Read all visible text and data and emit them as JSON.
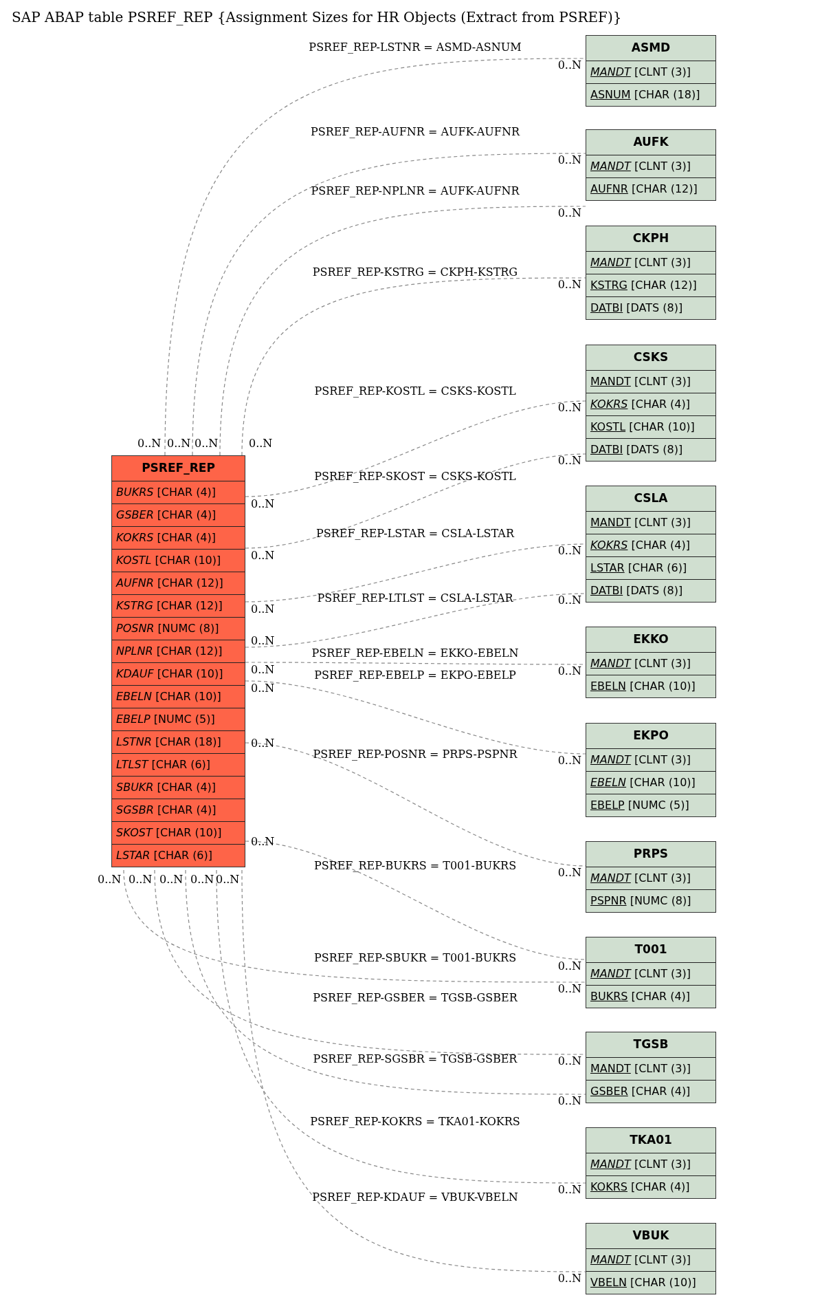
{
  "title": "SAP ABAP table PSREF_REP {Assignment Sizes for HR Objects (Extract from PSREF)}",
  "main_table": {
    "name": "PSREF_REP",
    "fields": [
      {
        "name": "BUKRS",
        "type": "[CHAR (4)]",
        "primary_key": false,
        "foreign_key": true
      },
      {
        "name": "GSBER",
        "type": "[CHAR (4)]",
        "primary_key": false,
        "foreign_key": true
      },
      {
        "name": "KOKRS",
        "type": "[CHAR (4)]",
        "primary_key": false,
        "foreign_key": true
      },
      {
        "name": "KOSTL",
        "type": "[CHAR (10)]",
        "primary_key": false,
        "foreign_key": true
      },
      {
        "name": "AUFNR",
        "type": "[CHAR (12)]",
        "primary_key": false,
        "foreign_key": true
      },
      {
        "name": "KSTRG",
        "type": "[CHAR (12)]",
        "primary_key": false,
        "foreign_key": true
      },
      {
        "name": "POSNR",
        "type": "[NUMC (8)]",
        "primary_key": false,
        "foreign_key": true
      },
      {
        "name": "NPLNR",
        "type": "[CHAR (12)]",
        "primary_key": false,
        "foreign_key": true
      },
      {
        "name": "KDAUF",
        "type": "[CHAR (10)]",
        "primary_key": false,
        "foreign_key": true
      },
      {
        "name": "EBELN",
        "type": "[CHAR (10)]",
        "primary_key": false,
        "foreign_key": true
      },
      {
        "name": "EBELP",
        "type": "[NUMC (5)]",
        "primary_key": false,
        "foreign_key": true
      },
      {
        "name": "LSTNR",
        "type": "[CHAR (18)]",
        "primary_key": false,
        "foreign_key": true
      },
      {
        "name": "LTLST",
        "type": "[CHAR (6)]",
        "primary_key": false,
        "foreign_key": true
      },
      {
        "name": "SBUKR",
        "type": "[CHAR (4)]",
        "primary_key": false,
        "foreign_key": true
      },
      {
        "name": "SGSBR",
        "type": "[CHAR (4)]",
        "primary_key": false,
        "foreign_key": true
      },
      {
        "name": "SKOST",
        "type": "[CHAR (10)]",
        "primary_key": false,
        "foreign_key": true
      },
      {
        "name": "LSTAR",
        "type": "[CHAR (6)]",
        "primary_key": false,
        "foreign_key": true
      }
    ]
  },
  "tables": [
    {
      "name": "ASMD",
      "fields": [
        {
          "name": "MANDT",
          "type": "[CLNT (3)]",
          "primary_key": true,
          "foreign_key": true
        },
        {
          "name": "ASNUM",
          "type": "[CHAR (18)]",
          "primary_key": true,
          "foreign_key": false
        }
      ]
    },
    {
      "name": "AUFK",
      "fields": [
        {
          "name": "MANDT",
          "type": "[CLNT (3)]",
          "primary_key": true,
          "foreign_key": true
        },
        {
          "name": "AUFNR",
          "type": "[CHAR (12)]",
          "primary_key": true,
          "foreign_key": false
        }
      ]
    },
    {
      "name": "CKPH",
      "fields": [
        {
          "name": "MANDT",
          "type": "[CLNT (3)]",
          "primary_key": true,
          "foreign_key": true
        },
        {
          "name": "KSTRG",
          "type": "[CHAR (12)]",
          "primary_key": true,
          "foreign_key": false
        },
        {
          "name": "DATBI",
          "type": "[DATS (8)]",
          "primary_key": true,
          "foreign_key": false
        }
      ]
    },
    {
      "name": "CSKS",
      "fields": [
        {
          "name": "MANDT",
          "type": "[CLNT (3)]",
          "primary_key": true,
          "foreign_key": false
        },
        {
          "name": "KOKRS",
          "type": "[CHAR (4)]",
          "primary_key": true,
          "foreign_key": true
        },
        {
          "name": "KOSTL",
          "type": "[CHAR (10)]",
          "primary_key": true,
          "foreign_key": false
        },
        {
          "name": "DATBI",
          "type": "[DATS (8)]",
          "primary_key": true,
          "foreign_key": false
        }
      ]
    },
    {
      "name": "CSLA",
      "fields": [
        {
          "name": "MANDT",
          "type": "[CLNT (3)]",
          "primary_key": true,
          "foreign_key": false
        },
        {
          "name": "KOKRS",
          "type": "[CHAR (4)]",
          "primary_key": true,
          "foreign_key": true
        },
        {
          "name": "LSTAR",
          "type": "[CHAR (6)]",
          "primary_key": true,
          "foreign_key": false
        },
        {
          "name": "DATBI",
          "type": "[DATS (8)]",
          "primary_key": true,
          "foreign_key": false
        }
      ]
    },
    {
      "name": "EKKO",
      "fields": [
        {
          "name": "MANDT",
          "type": "[CLNT (3)]",
          "primary_key": true,
          "foreign_key": true
        },
        {
          "name": "EBELN",
          "type": "[CHAR (10)]",
          "primary_key": true,
          "foreign_key": false
        }
      ]
    },
    {
      "name": "EKPO",
      "fields": [
        {
          "name": "MANDT",
          "type": "[CLNT (3)]",
          "primary_key": true,
          "foreign_key": true
        },
        {
          "name": "EBELN",
          "type": "[CHAR (10)]",
          "primary_key": true,
          "foreign_key": true
        },
        {
          "name": "EBELP",
          "type": "[NUMC (5)]",
          "primary_key": true,
          "foreign_key": false
        }
      ]
    },
    {
      "name": "PRPS",
      "fields": [
        {
          "name": "MANDT",
          "type": "[CLNT (3)]",
          "primary_key": true,
          "foreign_key": true
        },
        {
          "name": "PSPNR",
          "type": "[NUMC (8)]",
          "primary_key": true,
          "foreign_key": false
        }
      ]
    },
    {
      "name": "T001",
      "fields": [
        {
          "name": "MANDT",
          "type": "[CLNT (3)]",
          "primary_key": true,
          "foreign_key": true
        },
        {
          "name": "BUKRS",
          "type": "[CHAR (4)]",
          "primary_key": true,
          "foreign_key": false
        }
      ]
    },
    {
      "name": "TGSB",
      "fields": [
        {
          "name": "MANDT",
          "type": "[CLNT (3)]",
          "primary_key": true,
          "foreign_key": false
        },
        {
          "name": "GSBER",
          "type": "[CHAR (4)]",
          "primary_key": true,
          "foreign_key": false
        }
      ]
    },
    {
      "name": "TKA01",
      "fields": [
        {
          "name": "MANDT",
          "type": "[CLNT (3)]",
          "primary_key": true,
          "foreign_key": true
        },
        {
          "name": "KOKRS",
          "type": "[CHAR (4)]",
          "primary_key": true,
          "foreign_key": false
        }
      ]
    },
    {
      "name": "VBUK",
      "fields": [
        {
          "name": "MANDT",
          "type": "[CLNT (3)]",
          "primary_key": true,
          "foreign_key": true
        },
        {
          "name": "VBELN",
          "type": "[CHAR (10)]",
          "primary_key": true,
          "foreign_key": false
        }
      ]
    }
  ],
  "relations": [
    {
      "label": "PSREF_REP-LSTNR = ASMD-ASNUM",
      "source_card": "0..N",
      "target_card": "0..N"
    },
    {
      "label": "PSREF_REP-AUFNR = AUFK-AUFNR",
      "source_card": "0..N",
      "target_card": "0..N"
    },
    {
      "label": "PSREF_REP-NPLNR = AUFK-AUFNR",
      "source_card": "0..N",
      "target_card": "0..N"
    },
    {
      "label": "PSREF_REP-KSTRG = CKPH-KSTRG",
      "source_card": "0..N",
      "target_card": "0..N"
    },
    {
      "label": "PSREF_REP-KOSTL = CSKS-KOSTL",
      "source_card": "0..N",
      "target_card": "0..N"
    },
    {
      "label": "PSREF_REP-SKOST = CSKS-KOSTL",
      "source_card": "0..N",
      "target_card": "0..N"
    },
    {
      "label": "PSREF_REP-LSTAR = CSLA-LSTAR",
      "source_card": "0..N",
      "target_card": "0..N"
    },
    {
      "label": "PSREF_REP-LTLST = CSLA-LSTAR",
      "source_card": "0..N",
      "target_card": "0..N"
    },
    {
      "label": "PSREF_REP-EBELN = EKKO-EBELN",
      "source_card": "0..N",
      "target_card": "0..N"
    },
    {
      "label": "PSREF_REP-EBELP = EKPO-EBELP",
      "source_card": "0..N",
      "target_card": "0..N"
    },
    {
      "label": "PSREF_REP-POSNR = PRPS-PSPNR",
      "source_card": "0..N",
      "target_card": "0..N"
    },
    {
      "label": "PSREF_REP-BUKRS = T001-BUKRS",
      "source_card": "0..N",
      "target_card": "0..N"
    },
    {
      "label": "PSREF_REP-SBUKR = T001-BUKRS",
      "source_card": "0..N",
      "target_card": "0..N"
    },
    {
      "label": "PSREF_REP-GSBER = TGSB-GSBER",
      "source_card": "0..N",
      "target_card": "0..N"
    },
    {
      "label": "PSREF_REP-SGSBR = TGSB-GSBER",
      "source_card": "0..N",
      "target_card": "0..N"
    },
    {
      "label": "PSREF_REP-KOKRS = TKA01-KOKRS",
      "source_card": "0..N",
      "target_card": "0..N"
    },
    {
      "label": "PSREF_REP-KDAUF = VBUK-VBELN",
      "source_card": "0..N",
      "target_card": "0..N"
    }
  ]
}
